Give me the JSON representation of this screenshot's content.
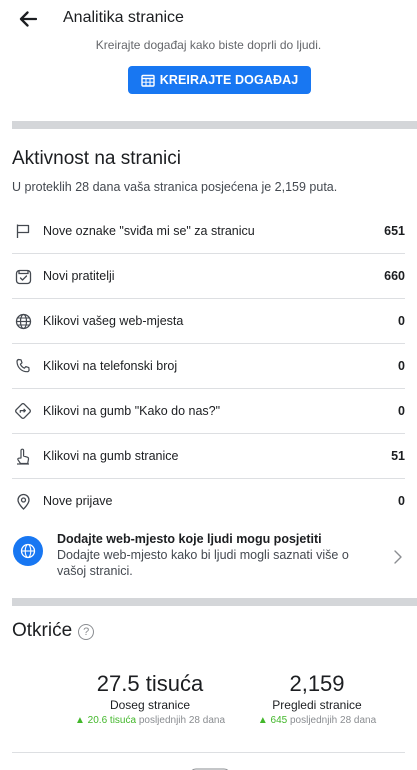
{
  "header": {
    "title": "Analitika stranice",
    "back_icon": "arrow-left-icon"
  },
  "event_promo": {
    "text": "Kreirajte događaj kako biste doprli do ljudi.",
    "button_label": "KREIRAJTE DOGAĐAJ",
    "button_icon": "calendar-icon",
    "accent": "#1877f2"
  },
  "activity": {
    "title": "Aktivnost na stranici",
    "subtitle": "U proteklih 28 dana vaša stranica posjećena je 2,159 puta.",
    "metrics": [
      {
        "icon": "flag-icon",
        "label": "Nove oznake \"sviđa mi se\" za stranicu",
        "value": "651"
      },
      {
        "icon": "follow-box-icon",
        "label": "Novi pratitelji",
        "value": "660"
      },
      {
        "icon": "globe-icon",
        "label": "Klikovi vašeg web-mjesta",
        "value": "0"
      },
      {
        "icon": "phone-icon",
        "label": "Klikovi na telefonski broj",
        "value": "0"
      },
      {
        "icon": "directions-icon",
        "label": "Klikovi na gumb \"Kako do nas?\"",
        "value": "0"
      },
      {
        "icon": "tap-finger-icon",
        "label": "Klikovi na gumb stranice",
        "value": "51"
      },
      {
        "icon": "location-pin-icon",
        "label": "Nove prijave",
        "value": "0"
      }
    ]
  },
  "website_card": {
    "icon": "globe-icon",
    "title": "Dodajte web-mjesto koje ljudi mogu posjetiti",
    "description": "Dodajte web-mjesto kako bi ljudi mogli saznati više o vašoj stranici.",
    "chevron_icon": "chevron-right-icon"
  },
  "discovery": {
    "title": "Otkriće",
    "help_icon": "question-circle-icon",
    "help_glyph": "?",
    "stats": [
      {
        "value": "27.5 tisuća",
        "label": "Doseg stranice",
        "trend_value": "20.6 tisuća",
        "trend_period": "posljednjih 28 dana"
      },
      {
        "value": "2,159",
        "label": "Pregledi stranice",
        "trend_value": "645",
        "trend_period": "posljednjih 28 dana"
      }
    ],
    "trend_up_symbol": "▲",
    "trend_color": "#42b72a"
  }
}
